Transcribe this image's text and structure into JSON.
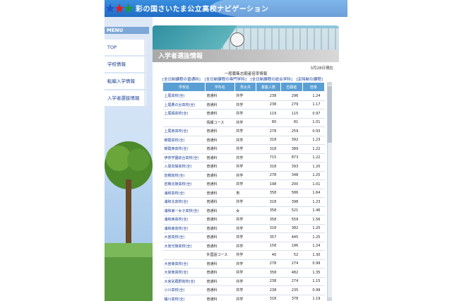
{
  "header": {
    "title": "彩の国さいたま公立高校ナビゲーション"
  },
  "sidebar": {
    "menu_label": "MENU",
    "items": [
      {
        "label": "TOP"
      },
      {
        "label": "学校情報"
      },
      {
        "label": "転編入学情報"
      },
      {
        "label": "入学者選抜情報"
      }
    ]
  },
  "main": {
    "title": "入学者選抜情報",
    "date": "3月28日現在",
    "section_title": "一般募集志願者倍率情報",
    "tabs": [
      "[全日制課程の普通科]",
      "[全日制課程の専門学科]",
      "[全日制課程の総合学科]",
      "[定時制の課程]"
    ],
    "table": {
      "headers": [
        "学校名",
        "学科名",
        "男女共",
        "募集人数",
        "志願者",
        "倍率"
      ],
      "rows": [
        [
          "上尾高校(全)",
          "普通科",
          "共学",
          "238",
          "296",
          "1.24"
        ],
        [
          "上尾鷹の台高校(全)",
          "普通科",
          "共学",
          "238",
          "279",
          "1.17"
        ],
        [
          "上尾橘高校(全)",
          "普通科",
          "共学",
          "119",
          "115",
          "0.97"
        ],
        [
          "",
          "情報コース",
          "共学",
          "80",
          "81",
          "1.01"
        ],
        [
          "上尾南高校(全)",
          "普通科",
          "共学",
          "278",
          "259",
          "0.93"
        ],
        [
          "朝霞高校(全)",
          "普通科",
          "共学",
          "318",
          "392",
          "1.23"
        ],
        [
          "朝霞西高校(全)",
          "普通科",
          "共学",
          "318",
          "389",
          "1.22"
        ],
        [
          "伊奈学園総合高校(全)",
          "普通科",
          "共学",
          "715",
          "873",
          "1.22"
        ],
        [
          "入間向陽高校(全)",
          "普通科",
          "共学",
          "318",
          "393",
          "1.20"
        ],
        [
          "岩槻高校(全)",
          "普通科",
          "共学",
          "278",
          "348",
          "1.25"
        ],
        [
          "岩槻北陵高校(全)",
          "普通科",
          "共学",
          "198",
          "200",
          "1.01"
        ],
        [
          "浦和高校(全)",
          "普通科",
          "男",
          "358",
          "586",
          "1.64"
        ],
        [
          "浦和北高校(全)",
          "普通科",
          "共学",
          "318",
          "398",
          "1.23"
        ],
        [
          "浦和第一女子高校(全)",
          "普通科",
          "女",
          "358",
          "521",
          "1.46"
        ],
        [
          "浦和西高校(全)",
          "普通科",
          "共学",
          "358",
          "559",
          "1.56"
        ],
        [
          "浦和東高校(全)",
          "普通科",
          "共学",
          "318",
          "382",
          "1.20"
        ],
        [
          "大宮高校(全)",
          "普通科",
          "共学",
          "357",
          "445",
          "1.25"
        ],
        [
          "大宮光陵高校(全)",
          "普通科",
          "共学",
          "158",
          "196",
          "1.24"
        ],
        [
          "",
          "外国語コース",
          "共学",
          "40",
          "52",
          "1.30"
        ],
        [
          "大宮東高校(全)",
          "普通科",
          "共学",
          "278",
          "274",
          "0.99"
        ],
        [
          "大宮南高校(全)",
          "普通科",
          "共学",
          "358",
          "482",
          "1.35"
        ],
        [
          "大宮武蔵野高校(全)",
          "普通科",
          "共学",
          "238",
          "274",
          "1.15"
        ],
        [
          "小川高校(全)",
          "普通科",
          "共学",
          "238",
          "235",
          "0.99"
        ],
        [
          "桶川高校(全)",
          "普通科",
          "共学",
          "318",
          "378",
          "1.19"
        ]
      ]
    }
  }
}
